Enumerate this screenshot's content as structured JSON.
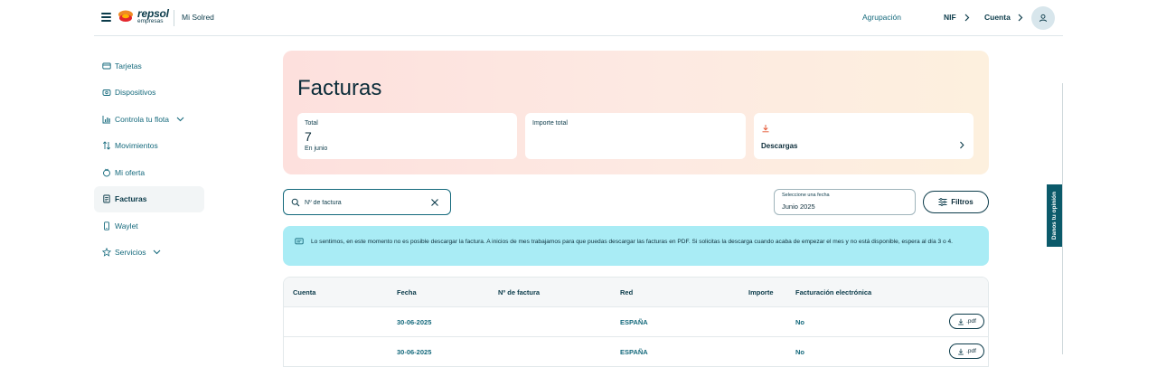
{
  "header": {
    "brand": "repsol",
    "brand_sub": "empresas",
    "app_name": "Mi Solred",
    "agrupacion": "Agrupación",
    "nif": "NIF",
    "cuenta": "Cuenta"
  },
  "sidebar": {
    "items": [
      {
        "label": "Tarjetas",
        "icon": "card-icon"
      },
      {
        "label": "Dispositivos",
        "icon": "device-icon"
      },
      {
        "label": "Controla tu flota",
        "icon": "chart-icon"
      },
      {
        "label": "Movimientos",
        "icon": "movements-icon"
      },
      {
        "label": "Mi oferta",
        "icon": "offer-icon"
      },
      {
        "label": "Facturas",
        "icon": "invoice-icon"
      },
      {
        "label": "Waylet",
        "icon": "phone-icon"
      },
      {
        "label": "Servicios",
        "icon": "star-icon"
      }
    ]
  },
  "hero": {
    "title": "Facturas",
    "total_label": "Total",
    "total_value": "7",
    "total_sub": "En junio",
    "importe_label": "Importe total",
    "descargas_label": "Descargas"
  },
  "search": {
    "placeholder": "Nº de factura"
  },
  "date_filter": {
    "label": "Seleccione una fecha",
    "value": "Junio 2025"
  },
  "filters_label": "Filtros",
  "alert": {
    "text": "Lo sentimos, en este momento no es posible descargar la factura. A inicios de mes trabajamos para que puedas descargar las facturas en PDF. Si solicitas la descarga cuando acaba de empezar el mes y no está disponible, espera al día 3 o 4."
  },
  "table": {
    "headers": {
      "cuenta": "Cuenta",
      "fecha": "Fecha",
      "numero": "Nº de factura",
      "red": "Red",
      "importe": "Importe",
      "electronica": "Facturación electrónica"
    },
    "rows": [
      {
        "cuenta": "",
        "fecha": "30-06-2025",
        "numero": "",
        "red": "ESPAÑA",
        "importe": "",
        "electronica": "No",
        "pdf": ".pdf"
      },
      {
        "cuenta": "",
        "fecha": "30-06-2025",
        "numero": "",
        "red": "ESPAÑA",
        "importe": "",
        "electronica": "No",
        "pdf": ".pdf"
      }
    ]
  },
  "feedback": "Danos tu opinión",
  "colors": {
    "primary": "#0b3b4a",
    "link": "#14697c",
    "alert_bg": "#a9ecf5",
    "brand_orange": "#f08a24",
    "brand_red": "#e4262c"
  }
}
